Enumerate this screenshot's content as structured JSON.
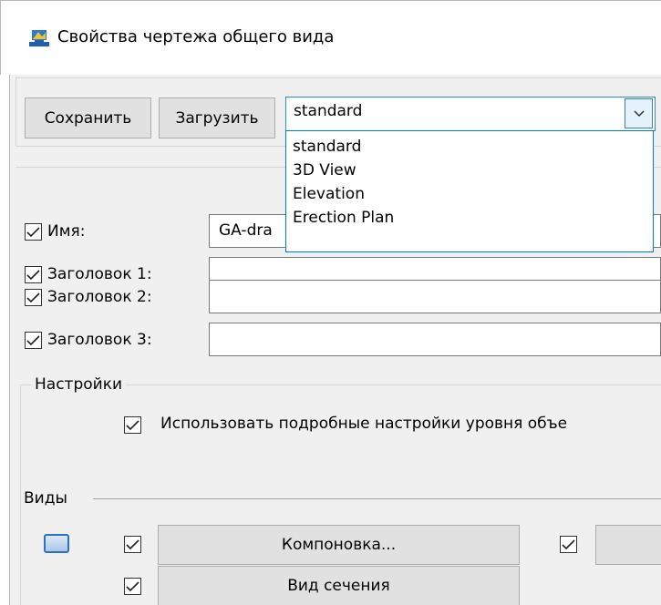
{
  "window": {
    "title": "Свойства чертежа общего вида",
    "icon": "drawing-properties-icon"
  },
  "toolbar": {
    "save_label": "Сохранить",
    "load_label": "Загрузить",
    "preset_value": "standard",
    "preset_options": [
      "standard",
      "3D View",
      "Elevation",
      "Erection Plan"
    ]
  },
  "fields": {
    "name_label": "Имя:",
    "name_value": "GA-dra",
    "title1_label": "Заголовок 1:",
    "title2_label": "Заголовок 2:",
    "title3_label": "Заголовок 3:"
  },
  "settings": {
    "group_label": "Настройки",
    "detailed_label": "Использовать подробные настройки уровня объе"
  },
  "views": {
    "group_label": "Виды",
    "layout_button": "Компоновка...",
    "section_button": "Вид сечения"
  },
  "colors": {
    "accent": "#0078d7",
    "panel": "#f0f0f0",
    "button": "#e1e1e1"
  }
}
